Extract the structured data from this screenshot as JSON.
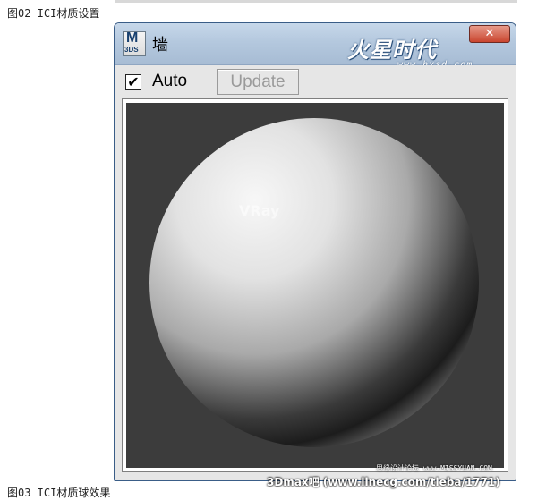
{
  "caption_top": "图02 ICI材质设置",
  "caption_bottom": "图03 ICI材质球效果",
  "window": {
    "app_icon": {
      "line1": "M",
      "line2": "3DS"
    },
    "title": "墙",
    "logo_text": "火星时代",
    "logo_url": "www.hxsd.com",
    "close_glyph": "✕"
  },
  "toolbar": {
    "auto_checked": true,
    "auto_label": "Auto",
    "update_label": "Update"
  },
  "preview": {
    "overlay_text": "VRay"
  },
  "watermarks": {
    "forum": "3Dmax吧  (www.linecg.com/tieba/1771)",
    "small": "思缘设计论坛 www.MISSYUAN.COM"
  }
}
